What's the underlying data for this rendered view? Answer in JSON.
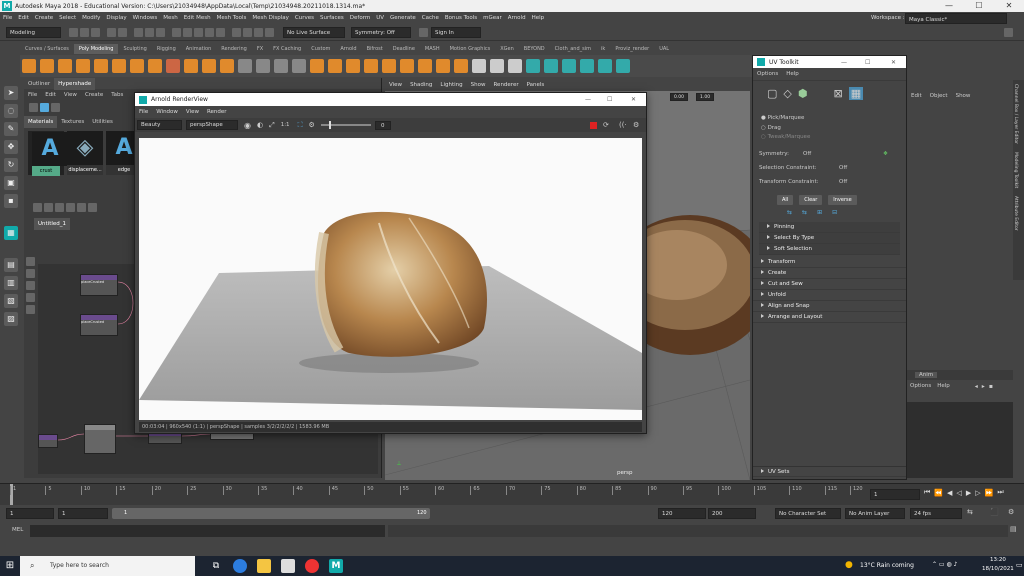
{
  "title_bar": {
    "title": "Autodesk Maya 2018 - Educational Version: C:\\Users\\21034948\\AppData\\Local\\Temp\\21034948.20211018.1314.ma*",
    "minimize": "—",
    "maximize": "☐",
    "close": "✕"
  },
  "menu": [
    "File",
    "Edit",
    "Create",
    "Select",
    "Modify",
    "Display",
    "Windows",
    "Mesh",
    "Edit Mesh",
    "Mesh Tools",
    "Mesh Display",
    "Curves",
    "Surfaces",
    "Deform",
    "UV",
    "Generate",
    "Cache",
    "Bonus Tools",
    "mGear",
    "Arnold",
    "Help"
  ],
  "workspace": {
    "label": "Workspace :",
    "value": "Maya Classic*"
  },
  "status_line": {
    "mode": "Modeling",
    "live_surface": "No Live Surface",
    "symmetry": "Symmetry: Off",
    "sign_in": "Sign In"
  },
  "shelf_tabs": [
    "Curves / Surfaces",
    "Poly Modeling",
    "Sculpting",
    "Rigging",
    "Animation",
    "Rendering",
    "FX",
    "FX Caching",
    "Custom",
    "Arnold",
    "Bifrost",
    "Deadline",
    "MASH",
    "Motion Graphics",
    "XGen",
    "BEYOND",
    "Cloth_and_sim",
    "ik",
    "Proviz_render",
    "UAL"
  ],
  "shelf_active": "Poly Modeling",
  "hypershade": {
    "tabs": [
      "Outliner",
      "Hypershade"
    ],
    "menu": [
      "File",
      "Edit",
      "View",
      "Create",
      "Tabs"
    ],
    "browser_tabs": [
      "Materials",
      "Textures",
      "Utilities"
    ],
    "materials": [
      "crust",
      "displaceme...",
      "edge"
    ],
    "editor_tab": "Untitled_1",
    "nodes": [
      "placeCrusted",
      "placeCrusted",
      "aiImage"
    ]
  },
  "viewport": {
    "menu": [
      "View",
      "Shading",
      "Lighting",
      "Show",
      "Renderer",
      "Panels"
    ],
    "camera": "persp",
    "value_a": "0.00",
    "value_b": "1.00"
  },
  "render_view": {
    "title": "Arnold RenderView",
    "menu": [
      "File",
      "Window",
      "View",
      "Render"
    ],
    "aov": "Beauty",
    "camera": "perspShape",
    "ratio": "1:1",
    "exposure": "0",
    "status": "00:03:04 | 960x540 (1:1) | perspShape | samples 3/2/2/2/2/2 | 1583.96 MB"
  },
  "uv_toolkit": {
    "title": "UV Toolkit",
    "menu": [
      "Options",
      "Help"
    ],
    "tools": [
      "Pick/Marquee",
      "Drag",
      "Tweak/Marquee"
    ],
    "symmetry": {
      "label": "Symmetry:",
      "value": "Off"
    },
    "selection_constraint": {
      "label": "Selection Constraint:",
      "value": "Off"
    },
    "transform_constraint": {
      "label": "Transform Constraint:",
      "value": "Off"
    },
    "buttons": [
      "All",
      "Clear",
      "Inverse"
    ],
    "sections_a": [
      "Pinning",
      "Select By Type",
      "Soft Selection"
    ],
    "sections_b": [
      "Transform",
      "Create",
      "Cut and Sew",
      "Unfold",
      "Align and Snap",
      "Arrange and Layout"
    ],
    "footer_section": "UV Sets"
  },
  "channel_box": {
    "menu": [
      "Edit",
      "Object",
      "Show"
    ],
    "anim_tab": "Anim",
    "options_menu": [
      "Options",
      "Help"
    ],
    "side_tabs": [
      "Channel Box / Layer Editor",
      "Modeling Toolkit",
      "Attribute Editor"
    ]
  },
  "timeline": {
    "ticks": [
      "1",
      "5",
      "10",
      "15",
      "20",
      "25",
      "30",
      "35",
      "40",
      "45",
      "50",
      "55",
      "60",
      "65",
      "70",
      "75",
      "80",
      "85",
      "90",
      "95",
      "100",
      "105",
      "110",
      "115",
      "120"
    ],
    "current_frame": "1"
  },
  "range": {
    "start": "1",
    "playback_start": "1",
    "range_start": "1",
    "range_end": "120",
    "playback_end": "120",
    "end": "200",
    "character_set": "No Character Set",
    "anim_layer": "No Anim Layer",
    "fps": "24 fps"
  },
  "command_line": {
    "lang": "MEL"
  },
  "taskbar": {
    "search_placeholder": "Type here to search",
    "weather": "13°C  Rain coming",
    "time": "13:20",
    "date": "18/10/2021"
  },
  "colors": {
    "maya_teal": "#1ab0b0",
    "bg": "#444444",
    "selected_material": "#5aaa88",
    "node_header": "#6a4b8d"
  }
}
